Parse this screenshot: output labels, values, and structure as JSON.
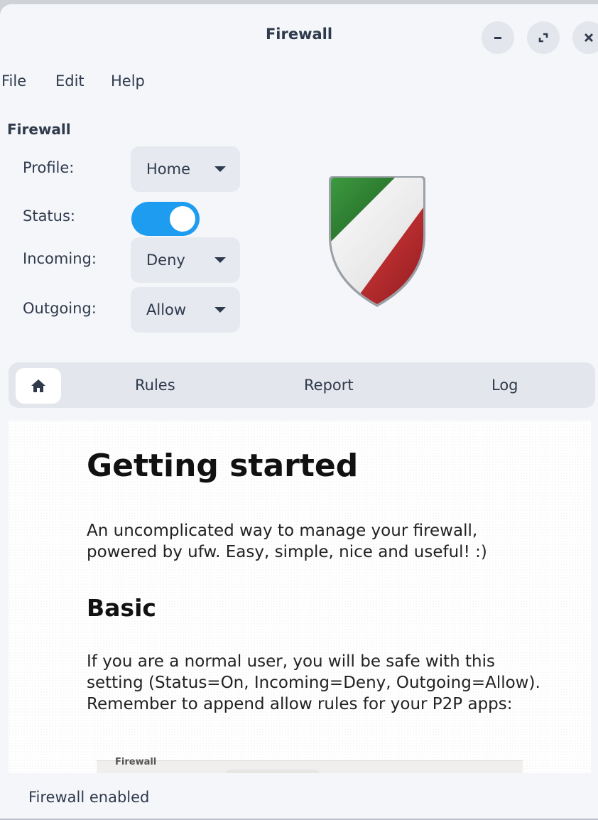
{
  "window": {
    "title": "Firewall"
  },
  "menu": {
    "file": "File",
    "edit": "Edit",
    "help": "Help"
  },
  "firewall": {
    "section_title": "Firewall",
    "profile": {
      "label": "Profile:",
      "value": "Home"
    },
    "status": {
      "label": "Status:",
      "on": true
    },
    "incoming": {
      "label": "Incoming:",
      "value": "Deny"
    },
    "outgoing": {
      "label": "Outgoing:",
      "value": "Allow"
    }
  },
  "tabs": {
    "home_icon": "home-icon",
    "rules": "Rules",
    "report": "Report",
    "log": "Log"
  },
  "content": {
    "heading": "Getting started",
    "intro": "An uncomplicated way to manage your firewall, powered by ufw. Easy, simple, nice and useful! :)",
    "basic_heading": "Basic",
    "basic_text": "If you are a normal user, you will be safe with this setting (Status=On, Incoming=Deny, Outgoing=Allow). Remember to append allow rules for your P2P apps:",
    "screenshot_title": "Firewall"
  },
  "statusbar": {
    "text": "Firewall enabled"
  },
  "colors": {
    "accent": "#1e9df0",
    "shield_green": "#2f7d32",
    "shield_red": "#c8302d"
  }
}
